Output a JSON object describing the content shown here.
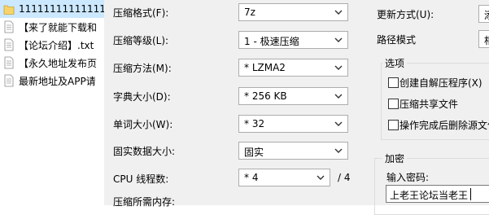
{
  "files": [
    {
      "name": "1111111111111111",
      "selected": true,
      "icon": "folder-icon"
    },
    {
      "name": "【来了就能下载和",
      "selected": false,
      "icon": "text-file-icon"
    },
    {
      "name": "【论坛介绍】.txt",
      "selected": false,
      "icon": "text-file-icon"
    },
    {
      "name": "【永久地址发布页",
      "selected": false,
      "icon": "text-file-icon"
    },
    {
      "name": "最新地址及APP请",
      "selected": false,
      "icon": "text-file-icon"
    }
  ],
  "settings": {
    "format": {
      "label": "压缩格式(F):",
      "value": "7z"
    },
    "level": {
      "label": "压缩等级(L):",
      "value": "1 - 极速压缩"
    },
    "method": {
      "label": "压缩方法(M):",
      "value": "* LZMA2"
    },
    "dict": {
      "label": "字典大小(D):",
      "value": "* 256 KB"
    },
    "word": {
      "label": "单词大小(W):",
      "value": "* 32"
    },
    "solid": {
      "label": "固实数据大小:",
      "value": "固实"
    },
    "cpu": {
      "label": "CPU 线程数:",
      "value": "* 4",
      "max": "/ 4"
    },
    "memory": {
      "label": "压缩所需内存:"
    }
  },
  "right": {
    "update": {
      "label": "更新方式(U):",
      "value": "添"
    },
    "path": {
      "label": "路径模式",
      "value": "相"
    },
    "options": {
      "title": "选项",
      "items": [
        {
          "label": "创建自解压程序(X)",
          "checked": false
        },
        {
          "label": "压缩共享文件",
          "checked": false
        },
        {
          "label": "操作完成后删除源文件",
          "checked": false
        }
      ]
    },
    "encryption": {
      "title": "加密",
      "password_label": "输入密码:",
      "password_value": "上老王论坛当老王"
    }
  }
}
